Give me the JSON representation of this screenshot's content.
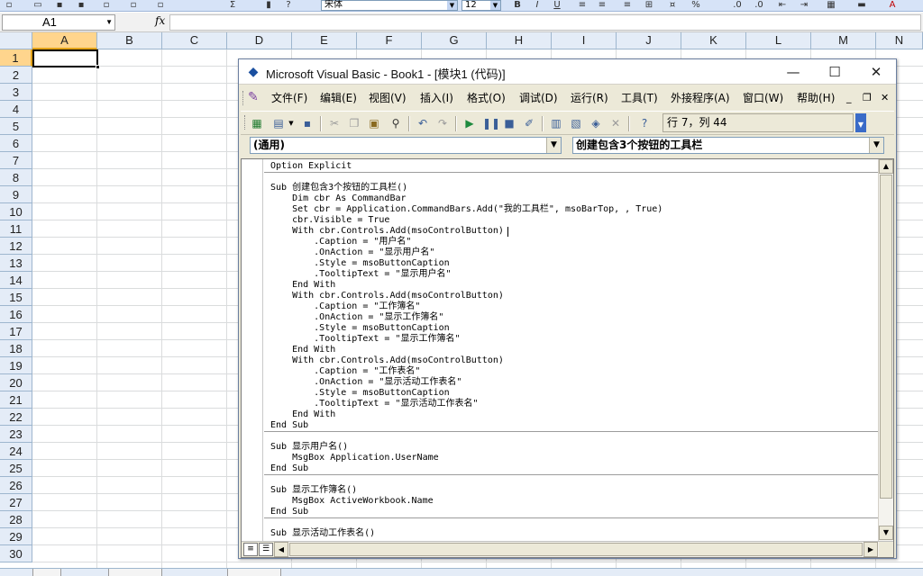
{
  "excel": {
    "toolbar": {
      "font_name": "宋体",
      "font_size": "12",
      "bold_label": "B",
      "italic_label": "I",
      "underline_label": "U"
    },
    "formula_bar": {
      "name_box": "A1",
      "fx_label": "fx",
      "formula_value": ""
    },
    "columns": [
      "A",
      "B",
      "C",
      "D",
      "E",
      "F",
      "G",
      "H",
      "I",
      "J",
      "K",
      "L",
      "M",
      "N"
    ],
    "rows": [
      "1",
      "2",
      "3",
      "4",
      "5",
      "6",
      "7",
      "8",
      "9",
      "10",
      "11",
      "12",
      "13",
      "14",
      "15",
      "16",
      "17",
      "18",
      "19",
      "20",
      "21",
      "22",
      "23",
      "24",
      "25",
      "26",
      "27",
      "28",
      "29",
      "30"
    ],
    "active_cell": "A1"
  },
  "vbe": {
    "title": "Microsoft Visual Basic - Book1 - [模块1 (代码)]",
    "window_controls": {
      "minimize": "—",
      "maximize": "☐",
      "close": "✕"
    },
    "menu": [
      "文件(F)",
      "编辑(E)",
      "视图(V)",
      "插入(I)",
      "格式(O)",
      "调试(D)",
      "运行(R)",
      "工具(T)",
      "外接程序(A)",
      "窗口(W)",
      "帮助(H)"
    ],
    "mdi_controls": {
      "minimize": "_",
      "restore": "❐",
      "close": "✕"
    },
    "position_text": "行 7，列 44",
    "object_combo": "(通用)",
    "procedure_combo": "创建包含3个按钮的工具栏",
    "code_lines": [
      "Option Explicit",
      "",
      "Sub 创建包含3个按钮的工具栏()",
      "    Dim cbr As CommandBar",
      "    Set cbr = Application.CommandBars.Add(\"我的工具栏\", msoBarTop, , True)",
      "    cbr.Visible = True",
      "    With cbr.Controls.Add(msoControlButton)",
      "        .Caption = \"用户名\"",
      "        .OnAction = \"显示用户名\"",
      "        .Style = msoButtonCaption",
      "        .TooltipText = \"显示用户名\"",
      "    End With",
      "    With cbr.Controls.Add(msoControlButton)",
      "        .Caption = \"工作簿名\"",
      "        .OnAction = \"显示工作簿名\"",
      "        .Style = msoButtonCaption",
      "        .TooltipText = \"显示工作簿名\"",
      "    End With",
      "    With cbr.Controls.Add(msoControlButton)",
      "        .Caption = \"工作表名\"",
      "        .OnAction = \"显示活动工作表名\"",
      "        .Style = msoButtonCaption",
      "        .TooltipText = \"显示活动工作表名\"",
      "    End With",
      "End Sub",
      "",
      "Sub 显示用户名()",
      "    MsgBox Application.UserName",
      "End Sub",
      "",
      "Sub 显示工作簿名()",
      "    MsgBox ActiveWorkbook.Name",
      "End Sub",
      "",
      "Sub 显示活动工作表名()"
    ]
  },
  "colors": {
    "excel_header_bg": "#e4ecf7",
    "excel_active_header": "#ffd58d",
    "vbe_chrome": "#ece9d8",
    "keyword": "#00007f"
  }
}
